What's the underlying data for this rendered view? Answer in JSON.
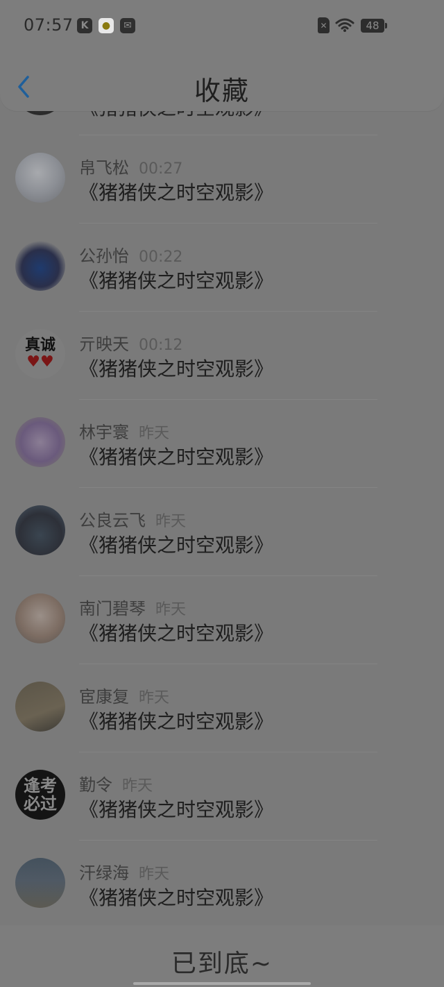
{
  "status_bar": {
    "time": "07:57",
    "battery": "48",
    "app_icons": [
      "k-app-icon",
      "chat-app-icon",
      "mail-app-icon"
    ]
  },
  "header": {
    "title": "收藏"
  },
  "partial_item": {
    "title": "《猪猪侠之时空观影》"
  },
  "items": [
    {
      "name": "帛飞松",
      "time": "00:27",
      "title": "《猪猪侠之时空观影》"
    },
    {
      "name": "公孙怡",
      "time": "00:22",
      "title": "《猪猪侠之时空观影》"
    },
    {
      "name": "亓映天",
      "time": "00:12",
      "title": "《猪猪侠之时空观影》",
      "avatar_text": "真诚"
    },
    {
      "name": "林宇寰",
      "time": "昨天",
      "title": "《猪猪侠之时空观影》"
    },
    {
      "name": "公良云飞",
      "time": "昨天",
      "title": "《猪猪侠之时空观影》"
    },
    {
      "name": "南门碧琴",
      "time": "昨天",
      "title": "《猪猪侠之时空观影》"
    },
    {
      "name": "宦康复",
      "time": "昨天",
      "title": "《猪猪侠之时空观影》"
    },
    {
      "name": "勤令",
      "time": "昨天",
      "title": "《猪猪侠之时空观影》",
      "avatar_text": "逢考必过"
    },
    {
      "name": "汗绿海",
      "time": "昨天",
      "title": "《猪猪侠之时空观影》"
    }
  ],
  "footer": {
    "text": "已到底~"
  },
  "colors": {
    "background": "#7a7a7a",
    "back_arrow": "#1f5f9a"
  }
}
